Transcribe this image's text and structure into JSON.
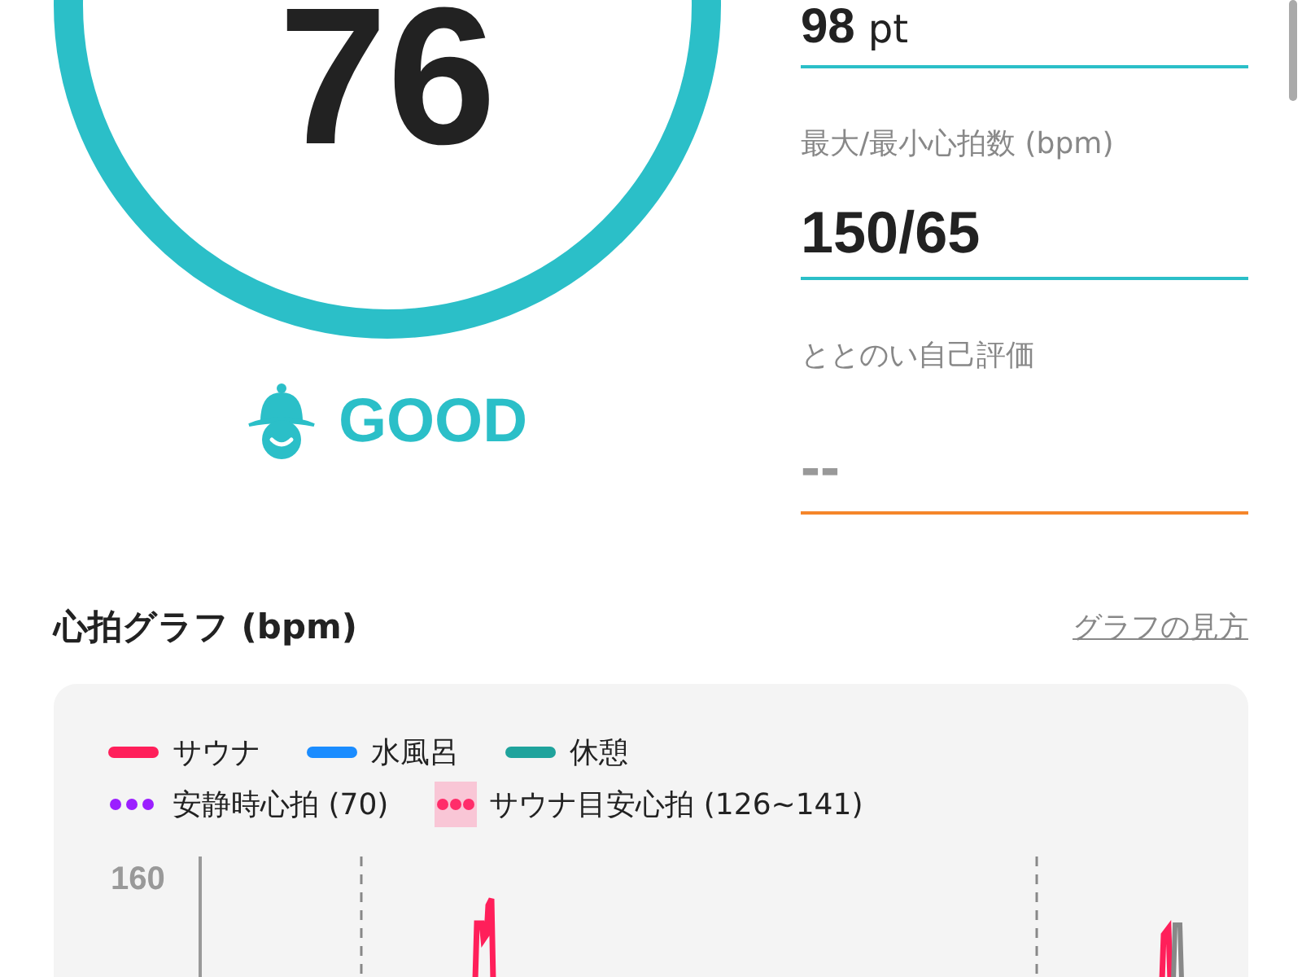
{
  "score": {
    "value": "76",
    "rating": "GOOD"
  },
  "stats": [
    {
      "value": "98",
      "unit": "pt",
      "empty": false,
      "color": "#2bbfc8"
    },
    {
      "label": "最大/最小心拍数 (bpm)",
      "value": "150/65",
      "empty": false,
      "color": "#2bbfc8"
    },
    {
      "label": "ととのい自己評価",
      "value": "--",
      "empty": true,
      "color": "#f5862a"
    }
  ],
  "graph": {
    "title": "心拍グラフ (bpm)",
    "help_link": "グラフの見方",
    "legend": [
      {
        "label": "サウナ",
        "kind": "line",
        "color": "#ff1f5a"
      },
      {
        "label": "水風呂",
        "kind": "line",
        "color": "#1a8cff"
      },
      {
        "label": "休憩",
        "kind": "line",
        "color": "#1fa39c"
      },
      {
        "label": "安静時心拍 (70)",
        "kind": "dots",
        "color": "#9b1fff"
      },
      {
        "label": "サウナ目安心拍 (126~141)",
        "kind": "band",
        "color": "#ff2d6a"
      }
    ],
    "y_tick": "160"
  }
}
